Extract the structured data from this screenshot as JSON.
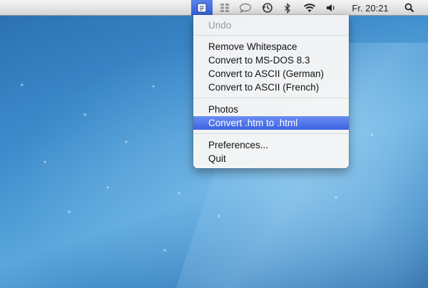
{
  "menubar": {
    "app_icon": "script-icon",
    "status_icons": [
      "grid-icon",
      "chat-bubble-icon",
      "time-machine-icon",
      "bluetooth-icon",
      "wifi-icon",
      "volume-icon"
    ],
    "clock": "Fr. 20:21",
    "search_icon": "spotlight-icon"
  },
  "menu": {
    "undo": "Undo",
    "remove_whitespace": "Remove Whitespace",
    "convert_msdos": "Convert to MS-DOS 8.3",
    "convert_ascii_german": "Convert to ASCII (German)",
    "convert_ascii_french": "Convert to ASCII (French)",
    "photos": "Photos",
    "convert_htm": "Convert .htm to .html",
    "preferences": "Preferences...",
    "quit": "Quit"
  },
  "colors": {
    "highlight": "#3b63e4",
    "desktop": "#3e8ccc"
  }
}
